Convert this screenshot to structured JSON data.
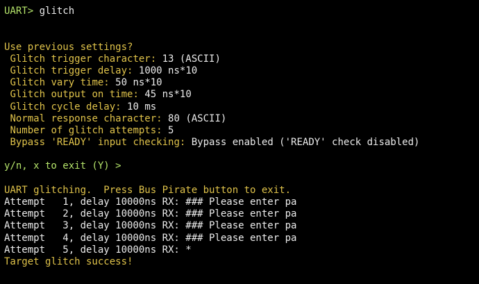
{
  "terminal": {
    "colors": {
      "background": "#000000",
      "prompt": "#b4e36a",
      "yellow": "#e0c34a",
      "white": "#ececec"
    },
    "cmd": {
      "prompt": "UART>",
      "command": "glitch"
    },
    "settings_heading": "Use previous settings?",
    "settings": [
      {
        "label": "Glitch trigger character:",
        "value": "13 (ASCII)"
      },
      {
        "label": "Glitch trigger delay:",
        "value": "1000 ns*10"
      },
      {
        "label": "Glitch vary time:",
        "value": "50 ns*10"
      },
      {
        "label": "Glitch output on time:",
        "value": "45 ns*10"
      },
      {
        "label": "Glitch cycle delay:",
        "value": "10 ms"
      },
      {
        "label": "Normal response character:",
        "value": "80 (ASCII)"
      },
      {
        "label": "Number of glitch attempts:",
        "value": "5"
      },
      {
        "label": "Bypass 'READY' input checking:",
        "value": "Bypass enabled ('READY' check disabled)"
      }
    ],
    "question": "y/n, x to exit (Y) >",
    "glitching_msg": "UART glitching.  Press Bus Pirate button to exit.",
    "attempts": [
      "Attempt   1, delay 10000ns RX: ### Please enter pa",
      "Attempt   2, delay 10000ns RX: ### Please enter pa",
      "Attempt   3, delay 10000ns RX: ### Please enter pa",
      "Attempt   4, delay 10000ns RX: ### Please enter pa",
      "Attempt   5, delay 10000ns RX: *"
    ],
    "success": "Target glitch success!"
  }
}
